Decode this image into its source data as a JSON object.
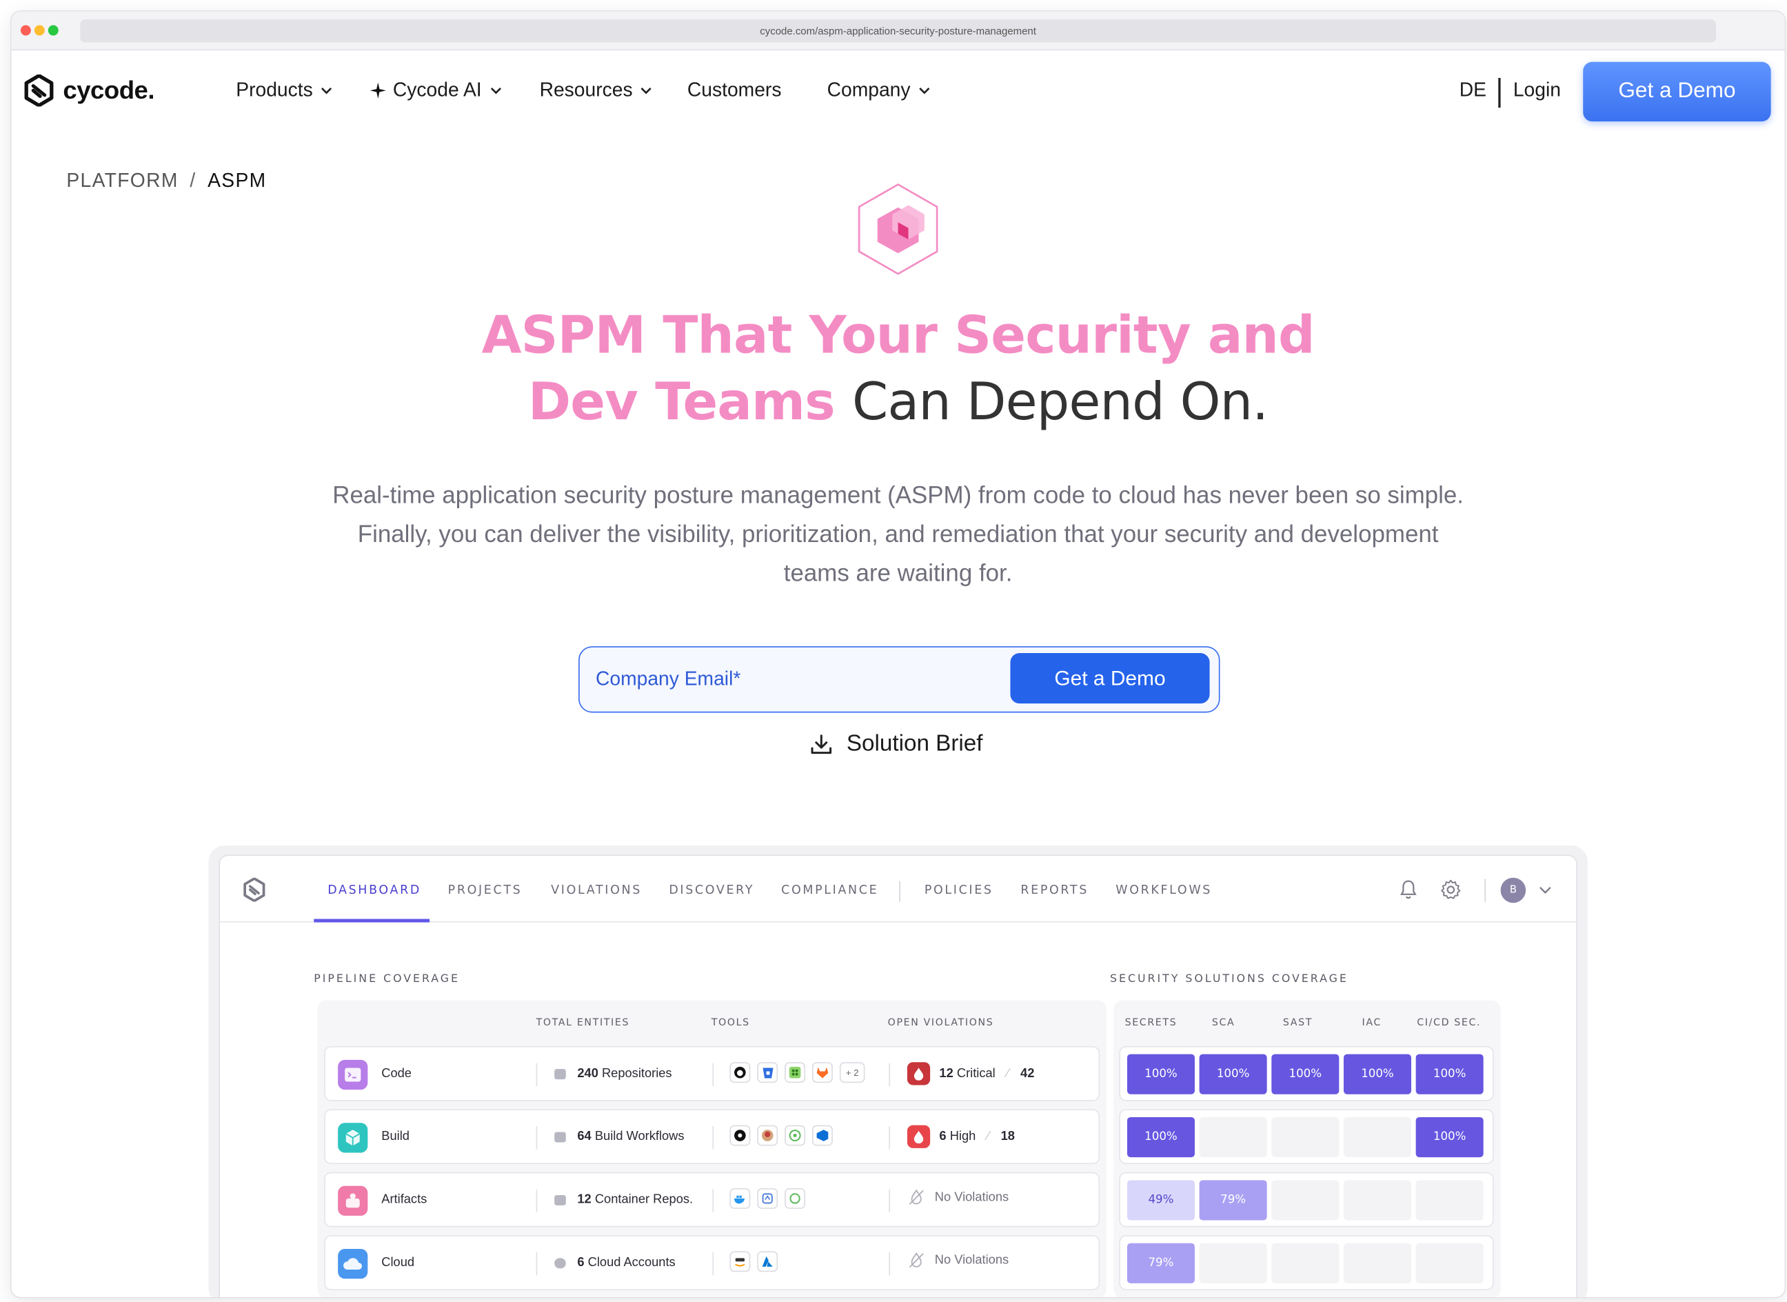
{
  "browser": {
    "url": "cycode.com/aspm-application-security-posture-management"
  },
  "nav": {
    "logo_text": "cycode.",
    "items": [
      {
        "label": "Products",
        "dropdown": true
      },
      {
        "label": "Cycode AI",
        "dropdown": true,
        "prefix_icon": "sparkle-icon"
      },
      {
        "label": "Resources",
        "dropdown": true
      },
      {
        "label": "Customers",
        "dropdown": false
      },
      {
        "label": "Company",
        "dropdown": true
      }
    ],
    "lang": "DE",
    "login": "Login",
    "cta": "Get a Demo"
  },
  "breadcrumb": {
    "parent": "PLATFORM",
    "separator": "/",
    "current": "ASPM"
  },
  "hero": {
    "headline_line1": "ASPM That Your Security and",
    "headline_line2_pink": "Dev Teams",
    "headline_line2_dark": "Can Depend On.",
    "subtext": "Real-time application security posture management (ASPM) from code to cloud has never been so simple. Finally, you can deliver the visibility, prioritization, and remediation that your security and development teams are waiting for.",
    "email_placeholder": "Company Email*",
    "form_cta": "Get a Demo",
    "brief_link": "Solution Brief",
    "accent_pink": "#f48cc4",
    "accent_blue": "#2563eb"
  },
  "dashboard": {
    "tabs": [
      "DASHBOARD",
      "PROJECTS",
      "VIOLATIONS",
      "DISCOVERY",
      "COMPLIANCE",
      "POLICIES",
      "REPORTS",
      "WORKFLOWS"
    ],
    "active_tab": "DASHBOARD",
    "avatar_initial": "B",
    "pipeline": {
      "title": "PIPELINE COVERAGE",
      "columns": [
        "TOTAL ENTITIES",
        "TOOLS",
        "OPEN VIOLATIONS"
      ],
      "rows": [
        {
          "name": "Code",
          "count": "240",
          "entity": "Repositories",
          "tools": [
            "github-icon",
            "bitbucket-icon",
            "gitlab-ci-icon",
            "gitlab-icon"
          ],
          "tools_more": "+ 2",
          "viol_count": "12",
          "viol_level": "Critical",
          "viol_total": "42",
          "color": "#b77de8"
        },
        {
          "name": "Build",
          "count": "64",
          "entity": "Build Workflows",
          "tools": [
            "circleci-icon",
            "jenkins-icon",
            "tekton-icon",
            "azure-devops-icon"
          ],
          "tools_more": "",
          "viol_count": "6",
          "viol_level": "High",
          "viol_total": "18",
          "color": "#2ec5c0"
        },
        {
          "name": "Artifacts",
          "count": "12",
          "entity": "Container Repos.",
          "tools": [
            "docker-icon",
            "harbor-icon",
            "quay-icon"
          ],
          "tools_more": "",
          "viol_none": "No Violations",
          "color": "#f07aa8"
        },
        {
          "name": "Cloud",
          "count": "6",
          "entity": "Cloud Accounts",
          "tools": [
            "aws-icon",
            "azure-icon"
          ],
          "tools_more": "",
          "viol_none": "No Violations",
          "color": "#4a97f0"
        }
      ]
    },
    "solutions": {
      "title": "SECURITY SOLUTIONS COVERAGE",
      "columns": [
        "SECRETS",
        "SCA",
        "SAST",
        "IAC",
        "CI/CD SEC."
      ],
      "rows": [
        [
          "100%",
          "100%",
          "100%",
          "100%",
          "100%"
        ],
        [
          "100%",
          "",
          "",
          "",
          "100%"
        ],
        [
          "49%",
          "79%",
          "",
          "",
          ""
        ],
        [
          "79%",
          "",
          "",
          "",
          ""
        ]
      ]
    }
  }
}
